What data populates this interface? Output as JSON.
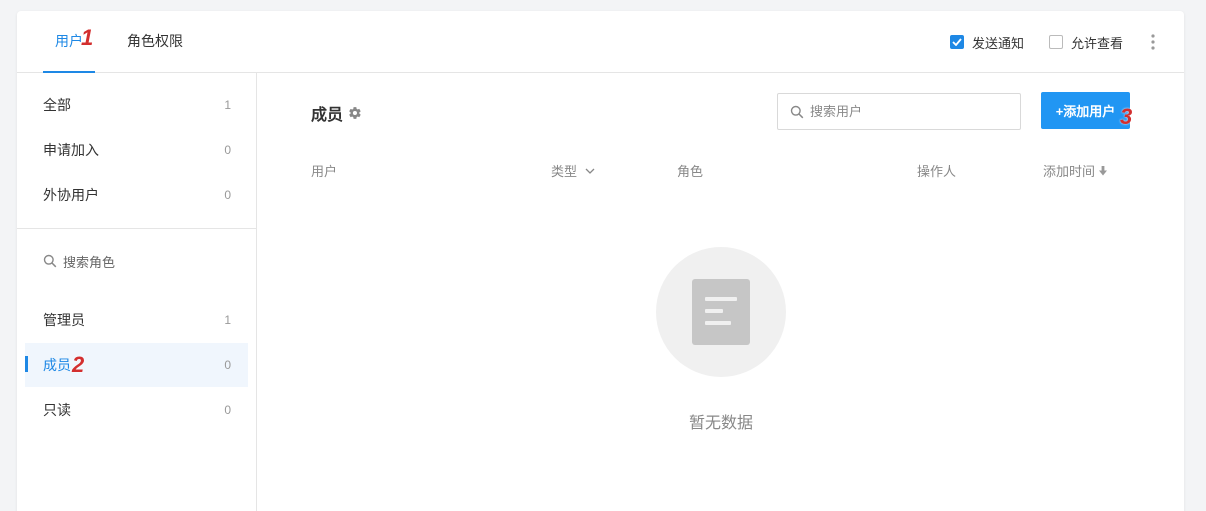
{
  "header": {
    "tabs": [
      {
        "label": "用户",
        "marker": "1"
      },
      {
        "label": "角色权限"
      }
    ],
    "send_notify": {
      "label": "发送通知",
      "checked": true
    },
    "allow_view": {
      "label": "允许查看",
      "checked": false
    }
  },
  "sidebar": {
    "groups": [
      {
        "label": "全部",
        "count": "1"
      },
      {
        "label": "申请加入",
        "count": "0"
      },
      {
        "label": "外协用户",
        "count": "0"
      }
    ],
    "role_search_placeholder": "搜索角色",
    "roles": [
      {
        "label": "管理员",
        "count": "1"
      },
      {
        "label": "成员",
        "count": "0",
        "marker": "2"
      },
      {
        "label": "只读",
        "count": "0"
      }
    ]
  },
  "main": {
    "title": "成员",
    "search_placeholder": "搜索用户",
    "add_button": {
      "label": "+添加用户",
      "marker": "3"
    },
    "columns": {
      "user": "用户",
      "type": "类型",
      "role": "角色",
      "operator": "操作人",
      "added_time": "添加时间"
    },
    "empty_text": "暂无数据"
  },
  "colors": {
    "accent": "#1e88e5",
    "button": "#2196f3",
    "marker": "#d32f2f"
  }
}
